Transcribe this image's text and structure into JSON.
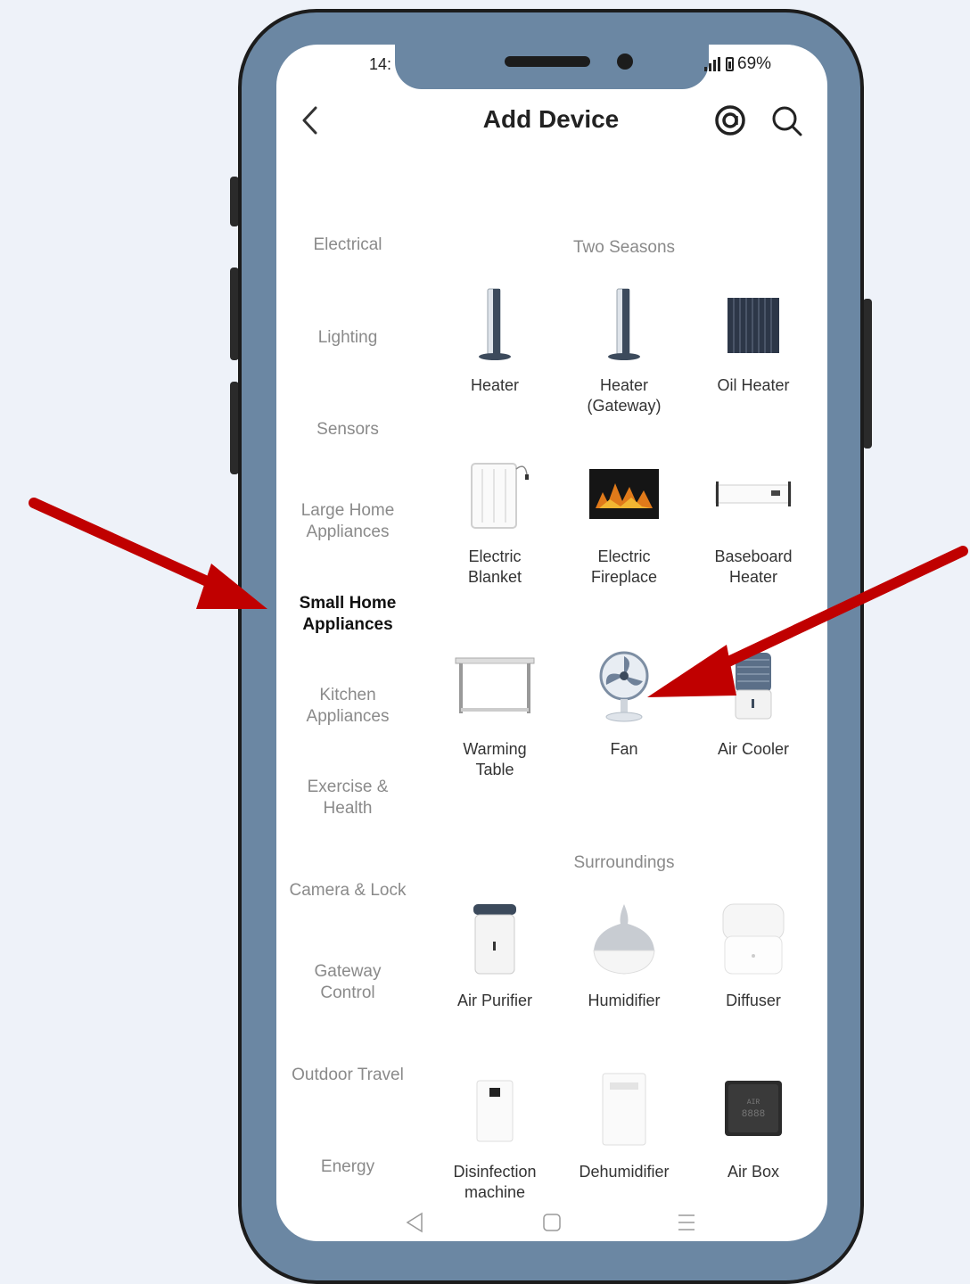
{
  "status_bar": {
    "time": "14:",
    "battery": "69%"
  },
  "header": {
    "title": "Add Device"
  },
  "categories": [
    {
      "label": "Electrical"
    },
    {
      "label": "Lighting"
    },
    {
      "label": "Sensors"
    },
    {
      "label": "Large Home\nAppliances"
    },
    {
      "label": "Small Home\nAppliances"
    },
    {
      "label": "Kitchen\nAppliances"
    },
    {
      "label": "Exercise &\nHealth"
    },
    {
      "label": "Camera & Lock"
    },
    {
      "label": "Gateway\nControl"
    },
    {
      "label": "Outdoor Travel"
    },
    {
      "label": "Energy"
    }
  ],
  "sections": [
    {
      "title": "Two Seasons"
    },
    {
      "title": "Surroundings"
    }
  ],
  "devices": [
    {
      "label": "Heater"
    },
    {
      "label": "Heater\n(Gateway)"
    },
    {
      "label": "Oil Heater"
    },
    {
      "label": "Electric\nBlanket"
    },
    {
      "label": "Electric\nFireplace"
    },
    {
      "label": "Baseboard\nHeater"
    },
    {
      "label": "Warming\nTable"
    },
    {
      "label": "Fan"
    },
    {
      "label": "Air Cooler"
    },
    {
      "label": "Air Purifier"
    },
    {
      "label": "Humidifier"
    },
    {
      "label": "Diffuser"
    },
    {
      "label": "Disinfection\nmachine"
    },
    {
      "label": "Dehumidifier"
    },
    {
      "label": "Air Box"
    }
  ],
  "colors": {
    "frame": "#6b87a3",
    "arrow": "#c00000",
    "background": "#eef2f9"
  }
}
